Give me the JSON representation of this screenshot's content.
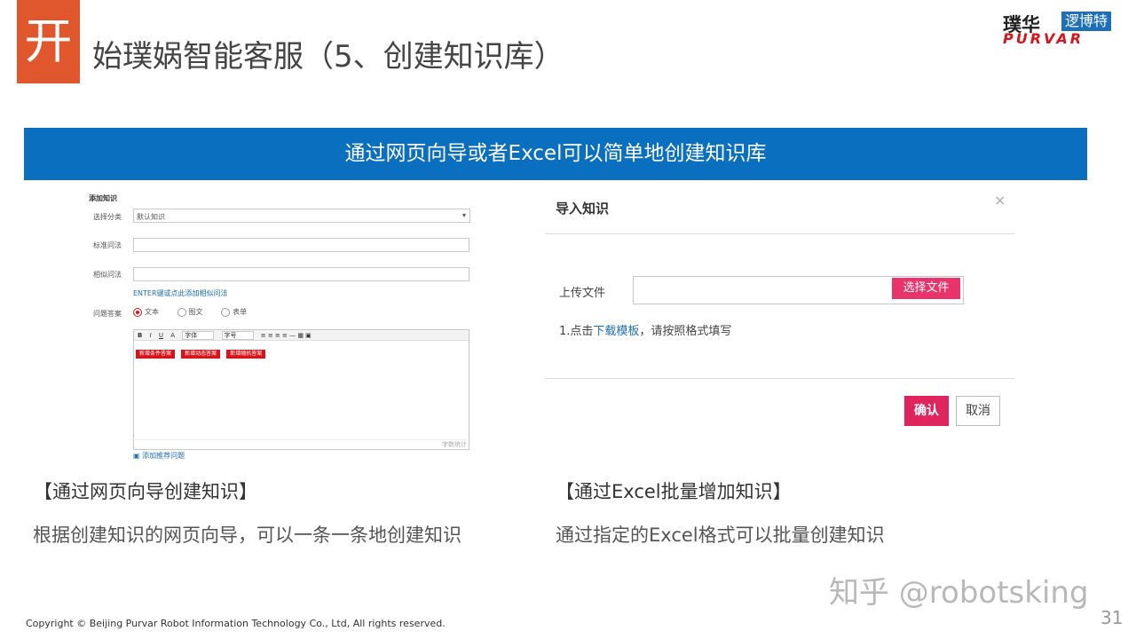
{
  "header": {
    "title_first_char": "开",
    "title_rest": "始璞娲智能客服（5、创建知识库）",
    "logo_cn": "璞华",
    "logo_box": "逻博特",
    "logo_en": "PURVAR"
  },
  "banner": "通过网页向导或者Excel可以简单地创建知识库",
  "form": {
    "heading": "添加知识",
    "category_label": "选择分类",
    "category_value": "默认知识",
    "standard_label": "标准问法",
    "similar_label": "相似问法",
    "similar_hint": "ENTER键或点此添加相似问法",
    "answer_label": "问题答案",
    "answer_options": [
      "文本",
      "图文",
      "表单"
    ],
    "toolbar": [
      "B",
      "I",
      "U",
      "A",
      "字体",
      "字号"
    ],
    "editor_buttons": [
      "新增条件答案",
      "新增动态答案",
      "新增随机答案"
    ],
    "char_count": "字数统计",
    "add_recommend": "添加推荐问题"
  },
  "dialog": {
    "title": "导入知识",
    "close": "×",
    "upload_label": "上传文件",
    "choose_button": "选择文件",
    "hint_prefix": "1.点击",
    "hint_link": "下载模板",
    "hint_suffix": "，请按照格式填写",
    "confirm": "确认",
    "cancel": "取消"
  },
  "left_caption": "【通过网页向导创建知识】",
  "left_sub": "根据创建知识的网页向导，可以一条一条地创建知识",
  "right_caption": "【通过Excel批量增加知识】",
  "right_sub": "通过指定的Excel格式可以批量创建知识",
  "footer": {
    "copyright": "Copyright © Beijing  Purvar Robot Information Technology Co., Ltd, All rights reserved.",
    "watermark": "知乎 @robotsking",
    "page": "31"
  }
}
